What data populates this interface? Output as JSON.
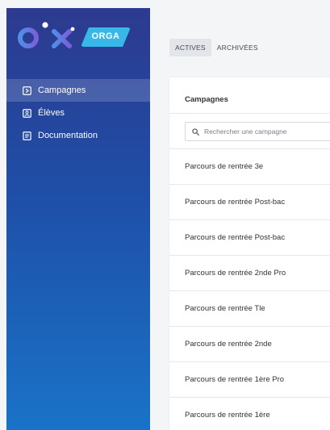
{
  "brand": {
    "logo_text": "pix",
    "badge": "ORGA"
  },
  "sidebar": {
    "items": [
      {
        "label": "Campagnes",
        "icon": "campaign-icon",
        "active": true
      },
      {
        "label": "Élèves",
        "icon": "students-icon",
        "active": false
      },
      {
        "label": "Documentation",
        "icon": "document-icon",
        "active": false
      }
    ]
  },
  "tabs": [
    {
      "label": "ACTIVES",
      "active": true
    },
    {
      "label": "ARCHIVÉES",
      "active": false
    }
  ],
  "panel": {
    "title": "Campagnes",
    "search_placeholder": "Rechercher une campagne",
    "rows": [
      "Parcours de rentrée 3e",
      "Parcours de rentrée Post-bac",
      "Parcours de rentrée Post-bac",
      "Parcours de rentrée 2nde Pro",
      "Parcours de rentrée Tle",
      "Parcours de rentrée 2nde",
      "Parcours de rentrée 1ère Pro",
      "Parcours de rentrée 1ère"
    ]
  },
  "colors": {
    "sidebar_top": "#2c3a8f",
    "sidebar_bottom": "#1a73c8",
    "badge": "#37b8e8",
    "background": "#f4f5f7"
  }
}
